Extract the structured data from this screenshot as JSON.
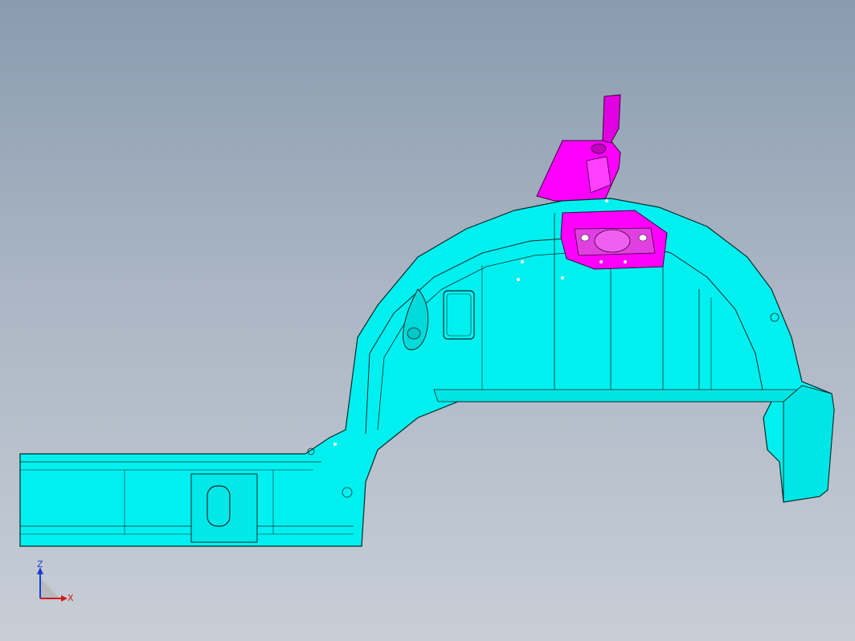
{
  "viewport": {
    "background_top": "#8a9bb0",
    "background_bottom": "#c8ced6"
  },
  "model": {
    "primary_color": "#00f0f0",
    "edge_color": "#0a2a2a",
    "highlight_color": "#ff00ff",
    "parts": [
      {
        "name": "rear-wheelhouse-inner-panel",
        "color": "#00f0f0"
      },
      {
        "name": "shock-tower-bracket",
        "color": "#ff00ff"
      }
    ]
  },
  "triad": {
    "z_label": "Z",
    "x_label": "X",
    "z_color": "#1a3fd0",
    "x_color": "#d01a1a"
  }
}
